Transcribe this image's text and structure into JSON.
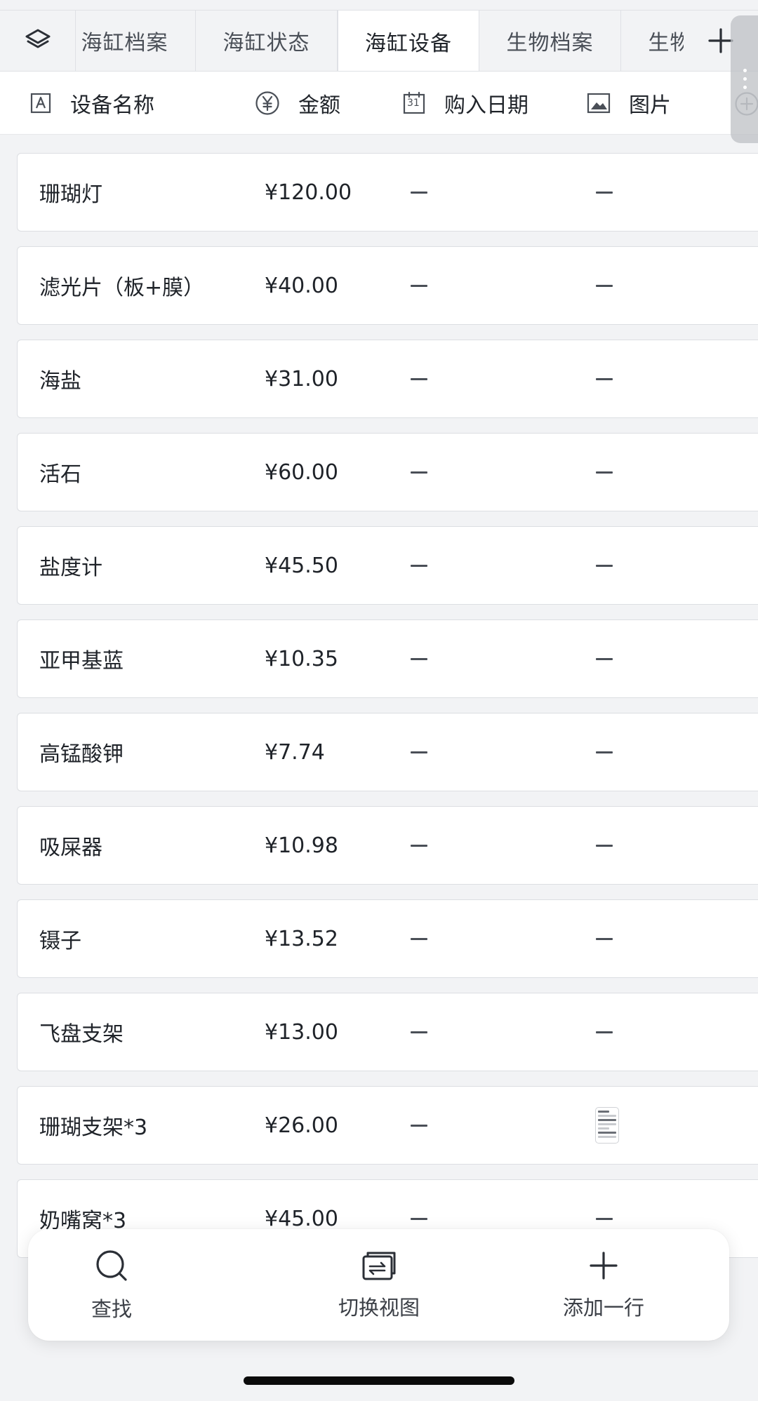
{
  "tabs": {
    "items": [
      {
        "label": "海缸档案"
      },
      {
        "label": "海缸状态"
      },
      {
        "label": "海缸设备",
        "active": true
      },
      {
        "label": "生物档案"
      },
      {
        "label": "生物状态"
      }
    ],
    "layers_icon": "layers-icon",
    "add_icon": "plus-icon"
  },
  "fields": [
    {
      "label": "设备名称",
      "icon": "text-field-icon"
    },
    {
      "label": "金额",
      "icon": "currency-yuan-icon"
    },
    {
      "label": "购入日期",
      "icon": "calendar-icon",
      "icon_text": "31"
    },
    {
      "label": "图片",
      "icon": "image-icon"
    }
  ],
  "rows": [
    {
      "name": "珊瑚灯",
      "price": "¥120.00",
      "date": "—",
      "image": "—"
    },
    {
      "name": "滤光片（板+膜）",
      "price": "¥40.00",
      "date": "—",
      "image": "—"
    },
    {
      "name": "海盐",
      "price": "¥31.00",
      "date": "—",
      "image": "—"
    },
    {
      "name": "活石",
      "price": "¥60.00",
      "date": "—",
      "image": "—"
    },
    {
      "name": "盐度计",
      "price": "¥45.50",
      "date": "—",
      "image": "—"
    },
    {
      "name": "亚甲基蓝",
      "price": "¥10.35",
      "date": "—",
      "image": "—"
    },
    {
      "name": "高锰酸钾",
      "price": "¥7.74",
      "date": "—",
      "image": "—"
    },
    {
      "name": "吸屎器",
      "price": "¥10.98",
      "date": "—",
      "image": "—"
    },
    {
      "name": "镊子",
      "price": "¥13.52",
      "date": "—",
      "image": "—"
    },
    {
      "name": "飞盘支架",
      "price": "¥13.00",
      "date": "—",
      "image": "—"
    },
    {
      "name": "珊瑚支架*3",
      "price": "¥26.00",
      "date": "—",
      "image": "thumbnail"
    },
    {
      "name": "奶嘴窝*3",
      "price": "¥45.00",
      "date": "—",
      "image": "—"
    }
  ],
  "toolbar": {
    "search_label": "查找",
    "switch_view_label": "切换视图",
    "add_row_label": "添加一行"
  },
  "colors": {
    "background": "#f2f3f5",
    "surface": "#ffffff",
    "text": "#1f2329",
    "muted_text": "#4a4f57",
    "border": "#dcdee2"
  }
}
